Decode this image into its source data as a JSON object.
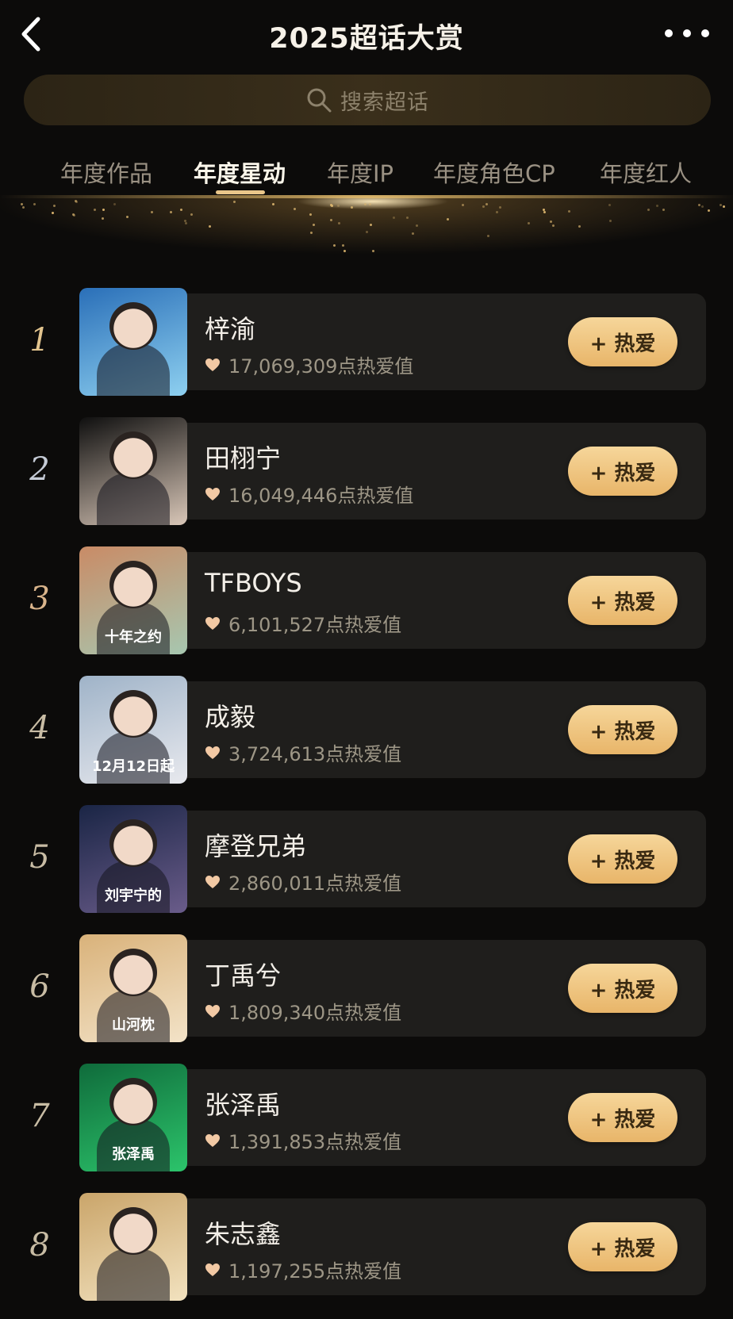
{
  "header": {
    "title": "2025超话大赏"
  },
  "search": {
    "placeholder": "搜索超话"
  },
  "tabs": [
    {
      "label": "年度作品",
      "active": false
    },
    {
      "label": "年度星动",
      "active": true
    },
    {
      "label": "年度IP",
      "active": false
    },
    {
      "label": "年度角色CP",
      "active": false
    },
    {
      "label": "年度红人",
      "active": false
    }
  ],
  "button_label": "+ 热爱",
  "ranking": [
    {
      "rank": "1",
      "name": "梓渝",
      "score": "17,069,309点热爱值",
      "thumb_caption": "",
      "thumb_colors": [
        "#2a6fb8",
        "#8ed0f0"
      ]
    },
    {
      "rank": "2",
      "name": "田栩宁",
      "score": "16,049,446点热爱值",
      "thumb_caption": "",
      "thumb_colors": [
        "#0f0f0f",
        "#d9c7b8"
      ]
    },
    {
      "rank": "3",
      "name": "TFBOYS",
      "score": "6,101,527点热爱值",
      "thumb_caption": "十年之约",
      "thumb_colors": [
        "#c98b66",
        "#a7c7b0"
      ]
    },
    {
      "rank": "4",
      "name": "成毅",
      "score": "3,724,613点热爱值",
      "thumb_caption": "12月12日起",
      "thumb_colors": [
        "#9fb3c8",
        "#e8e9ee"
      ]
    },
    {
      "rank": "5",
      "name": "摩登兄弟",
      "score": "2,860,011点热爱值",
      "thumb_caption": "刘宇宁的",
      "thumb_colors": [
        "#1a2545",
        "#6a5c8a"
      ]
    },
    {
      "rank": "6",
      "name": "丁禹兮",
      "score": "1,809,340点热爱值",
      "thumb_caption": "山河枕",
      "thumb_colors": [
        "#d9b27a",
        "#f3e3c8"
      ]
    },
    {
      "rank": "7",
      "name": "张泽禹",
      "score": "1,391,853点热爱值",
      "thumb_caption": "张泽禹",
      "thumb_colors": [
        "#0f6b3b",
        "#2cc46b"
      ]
    },
    {
      "rank": "8",
      "name": "朱志鑫",
      "score": "1,197,255点热爱值",
      "thumb_caption": "",
      "thumb_colors": [
        "#caa56a",
        "#f2e2bf"
      ]
    }
  ],
  "colors": {
    "accent": "#e9c68a",
    "button": "#f0c57f",
    "background": "#0c0b0a",
    "card": "#1f1e1c"
  }
}
